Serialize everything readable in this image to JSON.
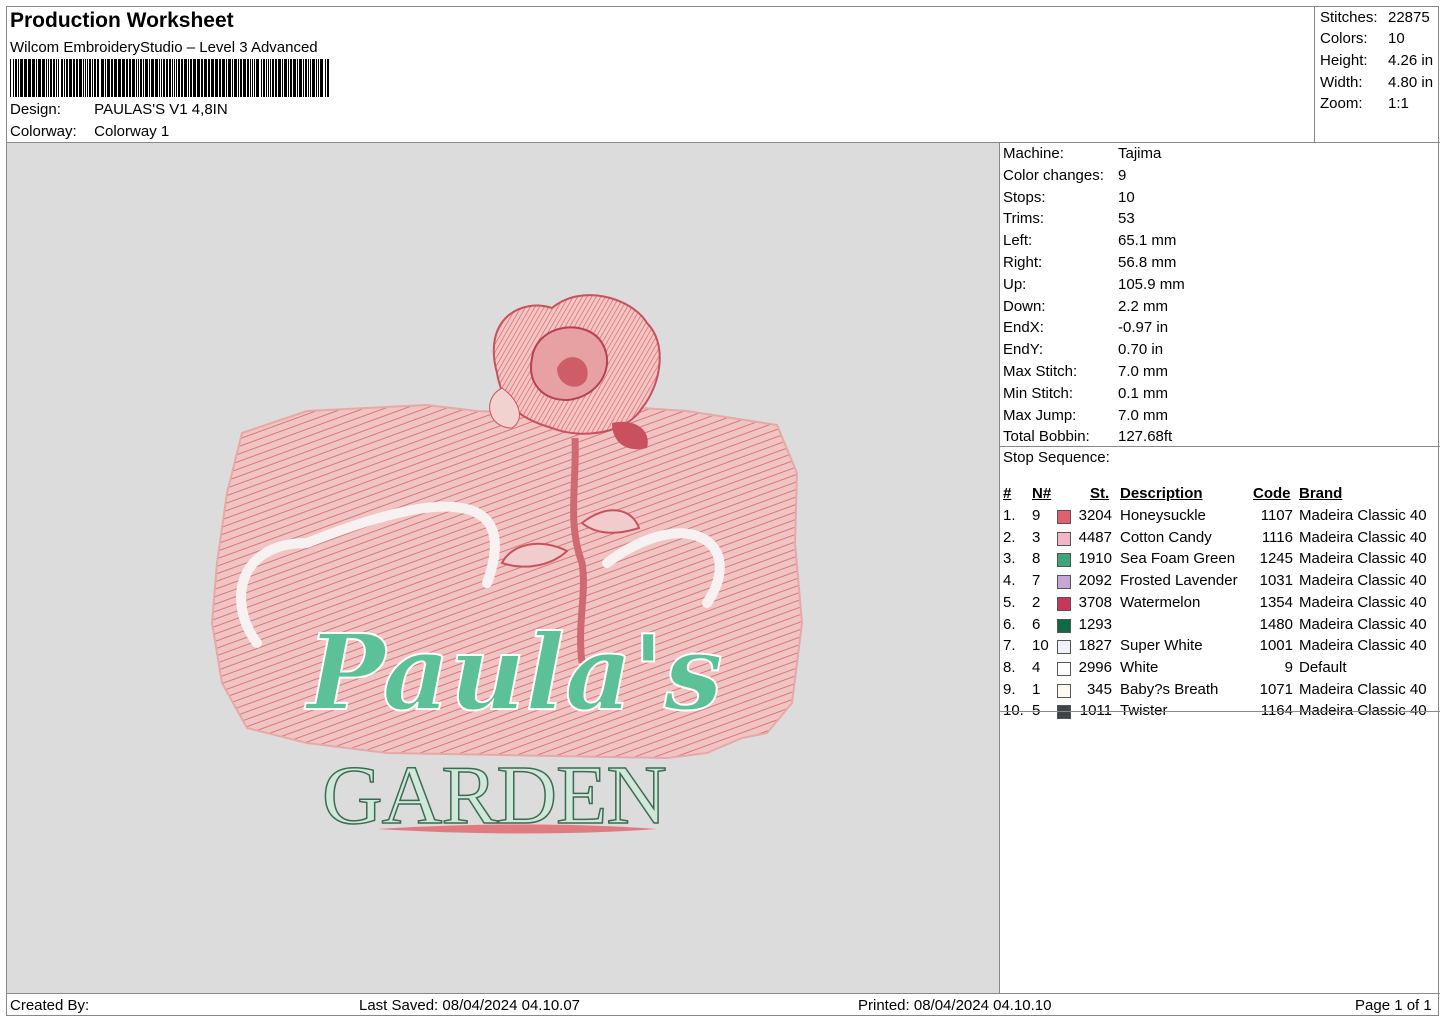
{
  "header": {
    "title": "Production Worksheet",
    "subtitle": "Wilcom EmbroideryStudio – Level 3 Advanced",
    "design_label": "Design:",
    "design_value": "PAULAS'S V1 4,8IN",
    "colorway_label": "Colorway:",
    "colorway_value": "Colorway 1"
  },
  "stats": [
    {
      "label": "Stitches:",
      "value": "22875"
    },
    {
      "label": "Colors:",
      "value": "10"
    },
    {
      "label": "Height:",
      "value": "4.26 in"
    },
    {
      "label": "Width:",
      "value": "4.80 in"
    },
    {
      "label": "Zoom:",
      "value": "1:1"
    }
  ],
  "machine_info": [
    {
      "label": "Machine:",
      "value": "Tajima"
    },
    {
      "label": "Color changes:",
      "value": "9"
    },
    {
      "label": "Stops:",
      "value": "10"
    },
    {
      "label": "Trims:",
      "value": "53"
    },
    {
      "label": "Left:",
      "value": "65.1 mm"
    },
    {
      "label": "Right:",
      "value": "56.8 mm"
    },
    {
      "label": "Up:",
      "value": "105.9 mm"
    },
    {
      "label": "Down:",
      "value": "2.2 mm"
    },
    {
      "label": "EndX:",
      "value": "-0.97 in"
    },
    {
      "label": "EndY:",
      "value": "0.70 in"
    },
    {
      "label": "Max Stitch:",
      "value": "7.0 mm"
    },
    {
      "label": "Min Stitch:",
      "value": "0.1 mm"
    },
    {
      "label": "Max Jump:",
      "value": "7.0 mm"
    },
    {
      "label": "Total Bobbin:",
      "value": "127.68ft"
    }
  ],
  "stop_sequence": {
    "title": "Stop Sequence:",
    "headers": {
      "num": "#",
      "needle": "N#",
      "st": "St.",
      "desc": "Description",
      "code": "Code",
      "brand": "Brand"
    },
    "rows": [
      {
        "num": "1.",
        "needle": "9",
        "color": "#e0606e",
        "st": "3204",
        "desc": "Honeysuckle",
        "code": "1107",
        "brand": "Madeira Classic 40"
      },
      {
        "num": "2.",
        "needle": "3",
        "color": "#f4b5c8",
        "st": "4487",
        "desc": "Cotton Candy",
        "code": "1116",
        "brand": "Madeira Classic 40"
      },
      {
        "num": "3.",
        "needle": "8",
        "color": "#3fa37e",
        "st": "1910",
        "desc": "Sea Foam Green",
        "code": "1245",
        "brand": "Madeira Classic 40"
      },
      {
        "num": "4.",
        "needle": "7",
        "color": "#c8a6d4",
        "st": "2092",
        "desc": "Frosted Lavender",
        "code": "1031",
        "brand": "Madeira Classic 40"
      },
      {
        "num": "5.",
        "needle": "2",
        "color": "#c8375a",
        "st": "3708",
        "desc": "Watermelon",
        "code": "1354",
        "brand": "Madeira Classic 40"
      },
      {
        "num": "6.",
        "needle": "6",
        "color": "#0e6a45",
        "st": "1293",
        "desc": "",
        "code": "1480",
        "brand": "Madeira Classic 40"
      },
      {
        "num": "7.",
        "needle": "10",
        "color": "#eef1fb",
        "st": "1827",
        "desc": "Super White",
        "code": "1001",
        "brand": "Madeira Classic 40"
      },
      {
        "num": "8.",
        "needle": "4",
        "color": "#ffffff",
        "st": "2996",
        "desc": "White",
        "code": "9",
        "brand": "Default"
      },
      {
        "num": "9.",
        "needle": "1",
        "color": "#fbf9f1",
        "st": "345",
        "desc": "Baby?s Breath",
        "code": "1071",
        "brand": "Madeira Classic 40"
      },
      {
        "num": "10.",
        "needle": "5",
        "color": "#3f4449",
        "st": "1011",
        "desc": "Twister",
        "code": "1164",
        "brand": "Madeira Classic 40"
      }
    ]
  },
  "design_preview": {
    "script_text": "Paula's",
    "garden_text": "GARDEN",
    "colors": {
      "background_patch": "#eab3b1",
      "rose": "#d86a73",
      "green": "#5cc196",
      "grey": "#dcdcdc"
    }
  },
  "footer": {
    "created_by": "Created By:",
    "last_saved": "Last Saved: 08/04/2024 04.10.07",
    "printed": "Printed: 08/04/2024 04.10.10",
    "page": "Page 1 of 1"
  }
}
